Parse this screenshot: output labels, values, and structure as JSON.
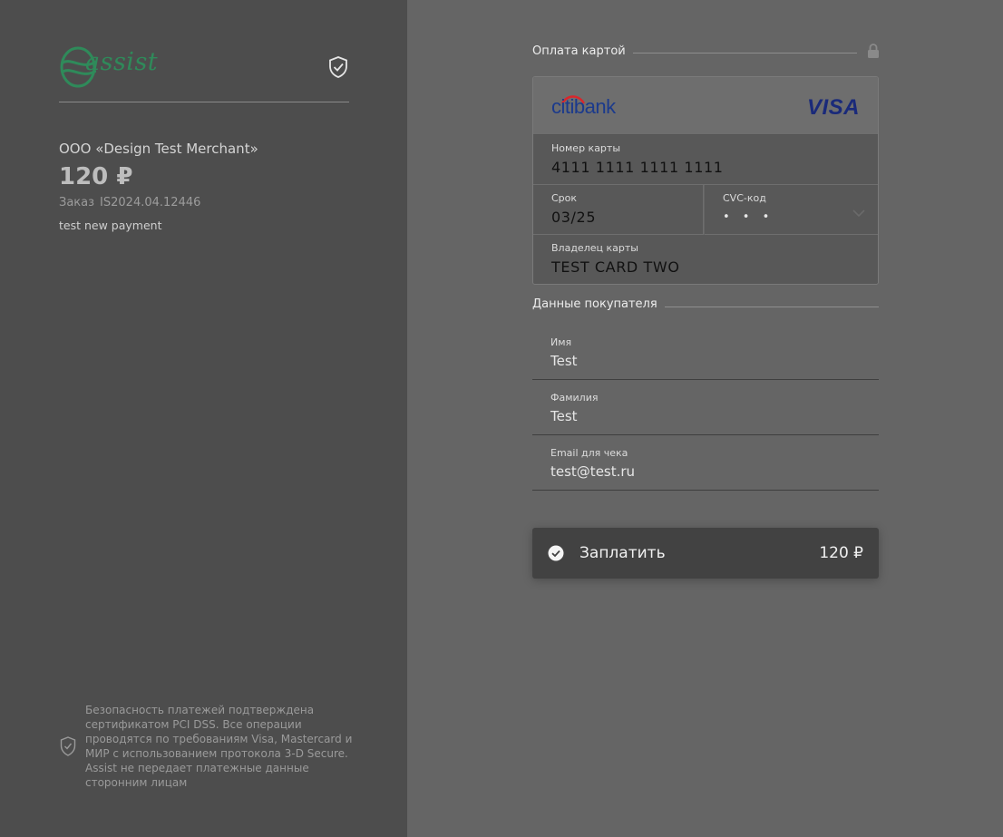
{
  "brand": {
    "logo_text": "assist"
  },
  "order": {
    "merchant": "ООО «Design Test Merchant»",
    "amount": "120 ₽",
    "order_label": "Заказ",
    "order_number": "IS2024.04.12446",
    "description": "test new payment"
  },
  "security_note": "Безопасность платежей подтверждена сертификатом PCI DSS. Все операции проводятся по требованиям Visa, Mastercard и МИР с использованием протокола 3-D Secure. Assist не передает платежные данные сторонним лицам",
  "card_section": {
    "title": "Оплата картой",
    "bank": "citibank",
    "network": "VISA",
    "number_label": "Номер карты",
    "number_value": "4111  1111  1111  1111",
    "expiry_label": "Срок",
    "expiry_value": "03/25",
    "cvc_label": "CVC-код",
    "cvc_value": "• • •",
    "holder_label": "Владелец карты",
    "holder_value": "TEST CARD TWO"
  },
  "buyer_section": {
    "title": "Данные покупателя",
    "fields": [
      {
        "label": "Имя",
        "value": "Test"
      },
      {
        "label": "Фамилия",
        "value": "Test"
      },
      {
        "label": "Email для чека",
        "value": "test@test.ru"
      }
    ]
  },
  "pay_button": {
    "label": "Заплатить",
    "amount": "120 ₽"
  },
  "icons": [
    "shield-check-icon",
    "lock-icon",
    "chevron-down-icon",
    "check-circle-icon"
  ],
  "colors": {
    "brand_green": "#2f8a5a",
    "left_panel": "#4d4d4d",
    "right_panel": "#656565",
    "button": "#424242"
  }
}
